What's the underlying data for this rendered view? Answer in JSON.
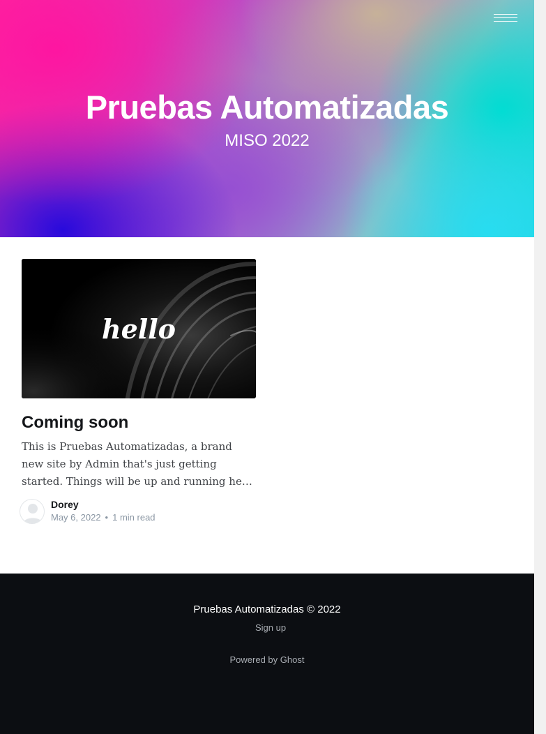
{
  "header": {
    "site_title": "Pruebas Automatizadas",
    "site_description": "MISO 2022",
    "menu_icon": "hamburger-menu-icon"
  },
  "posts": [
    {
      "image_text": "hello",
      "title": "Coming soon",
      "excerpt": "This is Pruebas Automatizadas, a brand new site by Admin that's just getting started. Things will be up and running here shortly, but you can subscribe in the meantime if you'd like to stay up to date and receive emails when new content is published!",
      "author": "Dorey",
      "date": "May 6, 2022",
      "separator": "•",
      "reading_time": "1 min read",
      "avatar_icon": "user-avatar-icon"
    }
  ],
  "footer": {
    "copyright": "Pruebas Automatizadas © 2022",
    "signup_label": "Sign up",
    "powered_by": "Powered by Ghost"
  },
  "colors": {
    "footer_background": "#0c0e12",
    "hero_pink": "#ff1493",
    "hero_blue": "#2a0ad8",
    "hero_cyan": "#1ad8e0",
    "meta_text": "#8a96a3"
  }
}
